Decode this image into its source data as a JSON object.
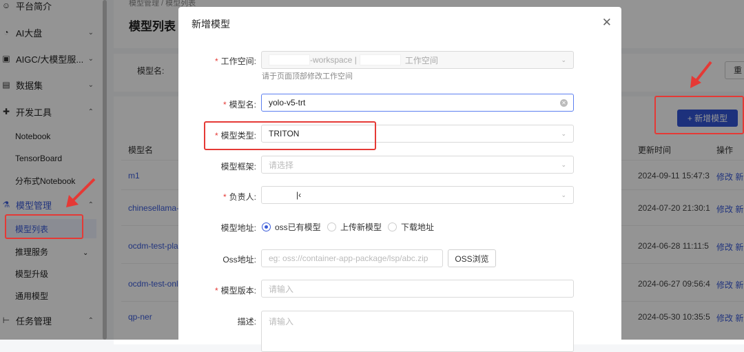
{
  "breadcrumb": "模型管理 / 模型列表",
  "page_title": "模型列表",
  "sidebar": {
    "items": [
      {
        "label": "平台简介"
      },
      {
        "label": "AI大盘"
      },
      {
        "label": "AIGC/大模型服..."
      },
      {
        "label": "数据集"
      },
      {
        "label": "开发工具"
      }
    ],
    "dev_sub": [
      "Notebook",
      "TensorBoard",
      "分布式Notebook"
    ],
    "model_mgmt": "模型管理",
    "model_sub": [
      "模型列表",
      "推理服务",
      "模型升级",
      "通用模型"
    ],
    "task_mgmt": "任务管理"
  },
  "filter": {
    "model_name_label": "模型名:",
    "reset_label": "重"
  },
  "add_button": "+ 新增模型",
  "table": {
    "headers": {
      "name": "模型名",
      "update_time": "更新时间",
      "actions": "操作"
    },
    "rows": [
      {
        "name": "m1",
        "time": "2024-09-11 15:47:3",
        "edit": "修改",
        "new": "新"
      },
      {
        "name": "chinesellama-",
        "time": "2024-07-20 21:30:1",
        "edit": "修改",
        "new": "新"
      },
      {
        "name": "ocdm-test-pla",
        "time": "2024-06-28 11:11:5",
        "edit": "修改",
        "new": "新"
      },
      {
        "name": "ocdm-test-onl",
        "time": "2024-06-27 09:56:4",
        "edit": "修改",
        "new": "新"
      },
      {
        "name": "qp-ner",
        "time": "2024-05-30 10:35:5",
        "edit": "修改",
        "new": "新"
      }
    ]
  },
  "dialog": {
    "title": "新增模型",
    "workspace": {
      "label": "工作空间:",
      "value_mid": "-workspace |",
      "value_end": "工作空间",
      "hint": "请于页面顶部修改工作空间"
    },
    "model_name": {
      "label": "模型名:",
      "value": "yolo-v5-trt"
    },
    "model_type": {
      "label": "模型类型:",
      "value": "TRITON"
    },
    "framework": {
      "label": "模型框架:",
      "placeholder": "请选择"
    },
    "owner": {
      "label": "负责人:",
      "value": "|‹"
    },
    "model_addr": {
      "label": "模型地址:",
      "options": [
        "oss已有模型",
        "上传新模型",
        "下载地址"
      ],
      "selected": "oss已有模型"
    },
    "oss_addr": {
      "label": "Oss地址:",
      "placeholder": "eg: oss://container-app-package/lsp/abc.zip",
      "browse": "OSS浏览"
    },
    "version": {
      "label": "模型版本:",
      "placeholder": "请输入"
    },
    "desc": {
      "label": "描述:",
      "placeholder": "请输入"
    }
  },
  "colors": {
    "primary": "#3355d6",
    "annotation": "#e53935"
  }
}
